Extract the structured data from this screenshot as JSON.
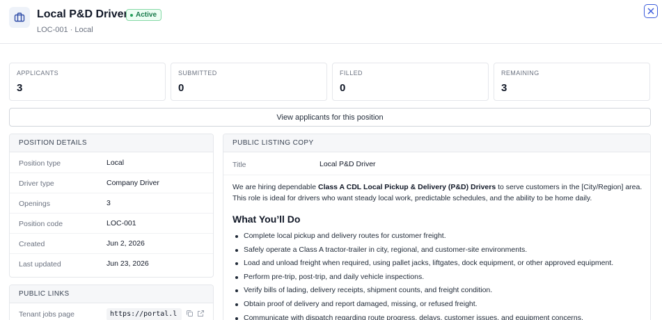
{
  "header": {
    "title": "Local P&D Driver",
    "status": "Active",
    "subtitle": "LOC-001 · Local",
    "icon": "briefcase-icon",
    "close_icon": "close-icon"
  },
  "stats": [
    {
      "label": "APPLICANTS",
      "value": "3"
    },
    {
      "label": "SUBMITTED",
      "value": "0"
    },
    {
      "label": "FILLED",
      "value": "0"
    },
    {
      "label": "REMAINING",
      "value": "3"
    }
  ],
  "view_button": "View applicants for this position",
  "position_details": {
    "heading": "POSITION DETAILS",
    "rows": [
      {
        "label": "Position type",
        "value": "Local"
      },
      {
        "label": "Driver type",
        "value": "Company Driver"
      },
      {
        "label": "Openings",
        "value": "3"
      },
      {
        "label": "Position code",
        "value": "LOC-001"
      },
      {
        "label": "Created",
        "value": "Jun 2, 2026"
      },
      {
        "label": "Last updated",
        "value": "Jun 23, 2026"
      }
    ]
  },
  "public_links": {
    "heading": "PUBLIC LINKS",
    "rows": [
      {
        "label": "Tenant jobs page",
        "value": "https://portal.l"
      }
    ]
  },
  "listing": {
    "heading": "PUBLIC LISTING COPY",
    "title_label": "Title",
    "title_value": "Local P&D Driver",
    "intro_prefix": "We are hiring dependable ",
    "intro_bold": "Class A CDL Local Pickup & Delivery (P&D) Drivers",
    "intro_suffix": " to serve customers in the [City/Region] area. This role is ideal for drivers who want steady local work, predictable schedules, and the ability to be home daily.",
    "section_heading": "What You’ll Do",
    "bullets": [
      "Complete local pickup and delivery routes for customer freight.",
      "Safely operate a Class A tractor-trailer in city, regional, and customer-site environments.",
      "Load and unload freight when required, using pallet jacks, liftgates, dock equipment, or other approved equipment.",
      "Perform pre-trip, post-trip, and daily vehicle inspections.",
      "Verify bills of lading, delivery receipts, shipment counts, and freight condition.",
      "Obtain proof of delivery and report damaged, missing, or refused freight.",
      "Communicate with dispatch regarding route progress, delays, customer issues, and equipment concerns."
    ]
  },
  "colors": {
    "accent": "#3b5bdb",
    "active_green": "#16794a",
    "border": "#e5e7eb"
  }
}
